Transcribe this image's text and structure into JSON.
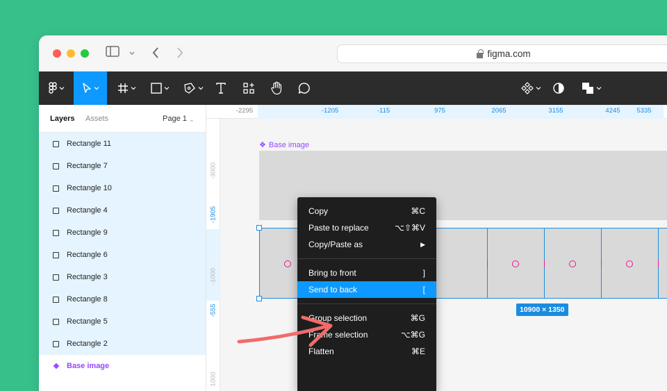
{
  "browser": {
    "url": "figma.com"
  },
  "toolbar": {
    "tools": [
      "main-menu",
      "move",
      "frame",
      "shape",
      "pen",
      "text",
      "resources",
      "hand",
      "comment"
    ],
    "right_tools": [
      "components",
      "contrast",
      "boolean"
    ]
  },
  "sidebar": {
    "tabs": {
      "layers": "Layers",
      "assets": "Assets",
      "page": "Page 1"
    },
    "layers": [
      "Rectangle 11",
      "Rectangle 7",
      "Rectangle 10",
      "Rectangle 4",
      "Rectangle 9",
      "Rectangle 6",
      "Rectangle 3",
      "Rectangle 8",
      "Rectangle 5",
      "Rectangle 2"
    ],
    "base_layer": "Base image"
  },
  "rulers": {
    "horizontal": [
      "-2295",
      "-1205",
      "-115",
      "975",
      "2065",
      "3155",
      "4245",
      "5335"
    ],
    "vertical": [
      "-3000",
      "-1905",
      "-1000",
      "-555",
      "1000"
    ]
  },
  "canvas": {
    "frame_label": "Base image",
    "selection_size": "10900 × 1350"
  },
  "context_menu": {
    "groups": [
      [
        {
          "label": "Copy",
          "shortcut": "⌘C"
        },
        {
          "label": "Paste to replace",
          "shortcut": "⌥⇧⌘V"
        },
        {
          "label": "Copy/Paste as",
          "shortcut": "▶"
        }
      ],
      [
        {
          "label": "Bring to front",
          "shortcut": "]"
        },
        {
          "label": "Send to back",
          "shortcut": "["
        }
      ],
      [
        {
          "label": "Group selection",
          "shortcut": "⌘G"
        },
        {
          "label": "Frame selection",
          "shortcut": "⌥⌘G"
        },
        {
          "label": "Flatten",
          "shortcut": "⌘E"
        }
      ]
    ],
    "highlighted": "Send to back"
  },
  "colors": {
    "accent": "#0d99ff",
    "background": "#38c08b",
    "component": "#9747ff",
    "arrow": "#f26b6b"
  }
}
